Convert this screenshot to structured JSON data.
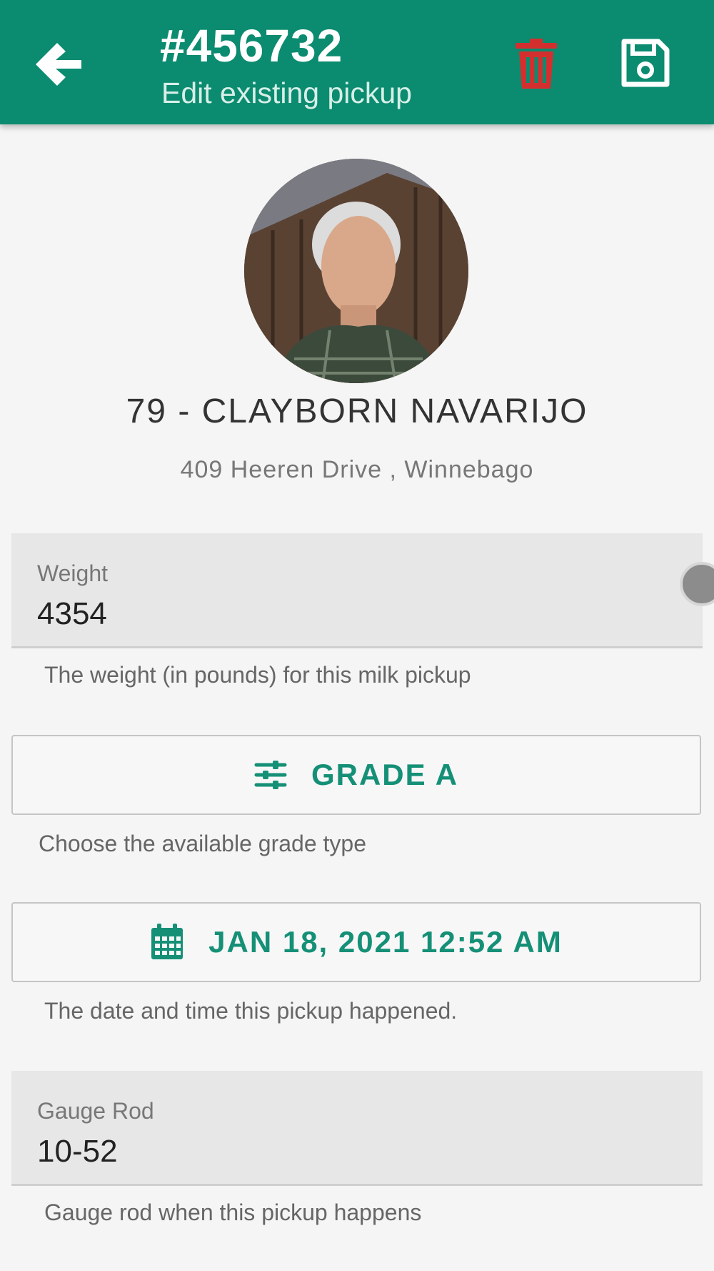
{
  "header": {
    "title": "#456732",
    "subtitle": "Edit existing pickup",
    "back_icon": "arrow-left-icon",
    "delete_icon": "trash-icon",
    "save_icon": "floppy-disk-icon",
    "delete_color": "#d32f2f",
    "background": "#0b8b6f"
  },
  "farmer": {
    "name": "79 - CLAYBORN NAVARIJO",
    "address": "409 Heeren Drive , Winnebago"
  },
  "weight": {
    "label": "Weight",
    "value": "4354",
    "helper": "The weight (in pounds) for this milk pickup"
  },
  "grade": {
    "label": "GRADE A",
    "icon": "sliders-icon",
    "helper": "Choose the available grade type"
  },
  "datetime": {
    "label": "JAN 18, 2021 12:52 AM",
    "icon": "calendar-icon",
    "helper": "The date and time this pickup happened."
  },
  "gauge": {
    "label": "Gauge Rod",
    "value": "10-52",
    "helper": "Gauge rod when this pickup happens"
  },
  "accent": "#159077"
}
